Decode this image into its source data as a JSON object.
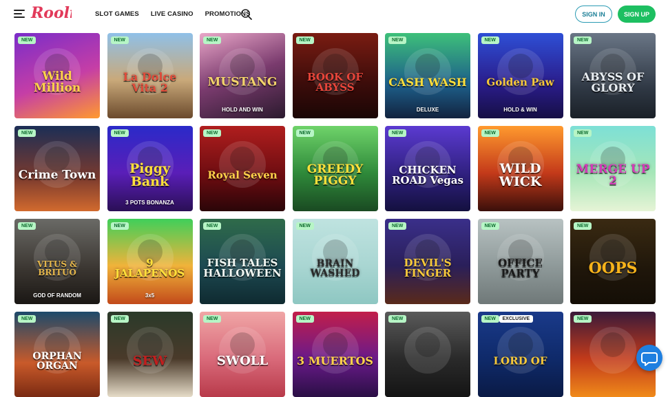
{
  "header": {
    "logo_text": "Rooli",
    "nav": [
      "SLOT GAMES",
      "LIVE CASINO",
      "PROMOTIONS"
    ],
    "sign_in": "SIGN IN",
    "sign_up": "SIGN UP"
  },
  "colors": {
    "accent": "#1dbf61",
    "outline": "#2a9bb3",
    "badge_bg": "#b7f5c6",
    "badge_text": "#0d6b2e"
  },
  "games": [
    {
      "title": "Wild Million",
      "sub": "",
      "badge": "NEW",
      "exclusive": "",
      "bg": "linear-gradient(160deg,#7a2dc9,#c53ea6 55%,#ff9a2e)",
      "color": "#ffd34a",
      "size": 17
    },
    {
      "title": "La Dolce Vita 2",
      "sub": "",
      "badge": "NEW",
      "exclusive": "",
      "bg": "linear-gradient(180deg,#8fc0e8,#c9a97a 55%,#6b4a2c)",
      "color": "#e04b3a",
      "size": 16
    },
    {
      "title": "MUSTANG",
      "sub": "HOLD AND WIN",
      "badge": "NEW",
      "exclusive": "",
      "bg": "linear-gradient(160deg,#e9a6c8,#7a3b6e 50%,#2b1a2e)",
      "color": "#f3d46a",
      "size": 17
    },
    {
      "title": "BOOK OF ABYSS",
      "sub": "",
      "badge": "NEW",
      "exclusive": "",
      "bg": "linear-gradient(180deg,#7a1c12,#3b0c0a 60%,#1a0605)",
      "color": "#e8453a",
      "size": 15
    },
    {
      "title": "CASH WASH",
      "sub": "DELUXE",
      "badge": "NEW",
      "exclusive": "",
      "bg": "linear-gradient(180deg,#3ec07a,#1d5f8a 60%,#12233f)",
      "color": "#ffde3a",
      "size": 16
    },
    {
      "title": "Golden Paw",
      "sub": "HOLD & WIN",
      "badge": "NEW",
      "exclusive": "",
      "bg": "linear-gradient(180deg,#2e4fd6,#2a1c8a 60%,#160f45)",
      "color": "#f7c93a",
      "size": 15
    },
    {
      "title": "ABYSS OF GLORY",
      "sub": "",
      "badge": "NEW",
      "exclusive": "",
      "bg": "linear-gradient(180deg,#6a7686,#2f3844 65%,#1a2027)",
      "color": "#e9eef2",
      "size": 16
    },
    {
      "title": "Crime Town",
      "sub": "",
      "badge": "NEW",
      "exclusive": "",
      "bg": "linear-gradient(180deg,#1b2e56,#7a3a2e 60%,#d26a2e)",
      "color": "#ffffff",
      "size": 17
    },
    {
      "title": "Piggy Bank",
      "sub": "3 POTS BONANZA",
      "badge": "NEW",
      "exclusive": "",
      "bg": "linear-gradient(180deg,#2a2ac9,#5a1eb8 55%,#2a0f55)",
      "color": "#ffe03a",
      "size": 19
    },
    {
      "title": "Royal Seven",
      "sub": "",
      "badge": "NEW",
      "exclusive": "",
      "bg": "linear-gradient(180deg,#b01e1e,#6a0c10 60%,#2a0508)",
      "color": "#ffd24a",
      "size": 15
    },
    {
      "title": "GREEDY PIGGY",
      "sub": "",
      "badge": "NEW",
      "exclusive": "",
      "bg": "linear-gradient(180deg,#6fd36a,#2f8a3a 55%,#1a4a22)",
      "color": "#ffe03a",
      "size": 17
    },
    {
      "title": "CHICKEN ROAD Vegas",
      "sub": "",
      "badge": "NEW",
      "exclusive": "",
      "bg": "linear-gradient(180deg,#5b3ad1,#2d1f7a 60%,#14103f)",
      "color": "#ffffff",
      "size": 15
    },
    {
      "title": "WILD WICK",
      "sub": "",
      "badge": "NEW",
      "exclusive": "",
      "bg": "linear-gradient(180deg,#ff9a2e,#c43a1a 55%,#3a0f0a)",
      "color": "#ffffff",
      "size": 19
    },
    {
      "title": "MERGE UP 2",
      "sub": "",
      "badge": "NEW",
      "exclusive": "",
      "bg": "linear-gradient(180deg,#7de0d6,#a6e6b8 55%,#e6f4d6)",
      "color": "#d33ab8",
      "size": 17
    },
    {
      "title": "VITUS & BRITUO",
      "sub": "GOD OF RANDOM",
      "badge": "NEW",
      "exclusive": "",
      "bg": "linear-gradient(180deg,#6a6a66,#3a3530 60%,#1a1714)",
      "color": "#e3b54a",
      "size": 12
    },
    {
      "title": "9 JALAPENOS",
      "sub": "3x5",
      "badge": "NEW",
      "exclusive": "",
      "bg": "linear-gradient(180deg,#3fcf5a,#f0b33a 55%,#c24a1a)",
      "color": "#ffe03a",
      "size": 15
    },
    {
      "title": "FISH TALES HALLOWEEN",
      "sub": "",
      "badge": "NEW",
      "exclusive": "",
      "bg": "linear-gradient(180deg,#2f6b4a,#1d4a52 55%,#0f2a30)",
      "color": "#f2f7f2",
      "size": 15
    },
    {
      "title": "BRAIN WASHED",
      "sub": "",
      "badge": "NEW",
      "exclusive": "",
      "bg": "linear-gradient(180deg,#bfe3e0,#a9d6d2 55%,#8ec7c2)",
      "color": "#2a2a2a",
      "size": 14
    },
    {
      "title": "DEVIL'S FINGER",
      "sub": "",
      "badge": "NEW",
      "exclusive": "",
      "bg": "linear-gradient(180deg,#3a2f8a,#2a1f5a 55%,#5a2a1a)",
      "color": "#f7c93a",
      "size": 15
    },
    {
      "title": "OFFICE PARTY",
      "sub": "",
      "badge": "NEW",
      "exclusive": "",
      "bg": "linear-gradient(180deg,#b8c2c2,#8f9a9a 55%,#6f7878)",
      "color": "#1a1a1a",
      "size": 15
    },
    {
      "title": "OOPS",
      "sub": "",
      "badge": "NEW",
      "exclusive": "",
      "bg": "linear-gradient(180deg,#3a2a12,#1f160a 60%,#140e06)",
      "color": "#f7b31a",
      "size": 22
    },
    {
      "title": "ORPHAN ORGAN",
      "sub": "",
      "badge": "NEW",
      "exclusive": "",
      "bg": "linear-gradient(180deg,#1d4a6b,#c95a2a 60%,#7a2a12)",
      "color": "#ffffff",
      "size": 14
    },
    {
      "title": "SEW",
      "sub": "",
      "badge": "NEW",
      "exclusive": "",
      "bg": "linear-gradient(180deg,#2a3a2a,#4a3a2a 55%,#e6dcc8)",
      "color": "#c21e1e",
      "size": 19
    },
    {
      "title": "SWOLL",
      "sub": "",
      "badge": "NEW",
      "exclusive": "",
      "bg": "linear-gradient(180deg,#f0a6a6,#d96a7a 55%,#b83a4a)",
      "color": "#ffffff",
      "size": 18
    },
    {
      "title": "3 MUERTOS",
      "sub": "",
      "badge": "NEW",
      "exclusive": "",
      "bg": "linear-gradient(180deg,#c21e4a,#6a1a8a 55%,#2a0f45)",
      "color": "#ffd24a",
      "size": 16
    },
    {
      "title": "",
      "sub": "",
      "badge": "NEW",
      "exclusive": "",
      "bg": "linear-gradient(180deg,#5a5a5a,#2a2a2a 55%,#141414)",
      "color": "#ffffff",
      "size": 16
    },
    {
      "title": "LORD OF",
      "sub": "",
      "badge": "NEW",
      "exclusive": "EXCLUSIVE",
      "bg": "linear-gradient(180deg,#1a3a8a,#0f2a6a 55%,#0a1a45)",
      "color": "#f7c93a",
      "size": 15
    },
    {
      "title": "",
      "sub": "",
      "badge": "NEW",
      "exclusive": "",
      "bg": "linear-gradient(180deg,#3a1a3a,#c23a1a 55%,#f08a1a)",
      "color": "#ffffff",
      "size": 16
    }
  ]
}
